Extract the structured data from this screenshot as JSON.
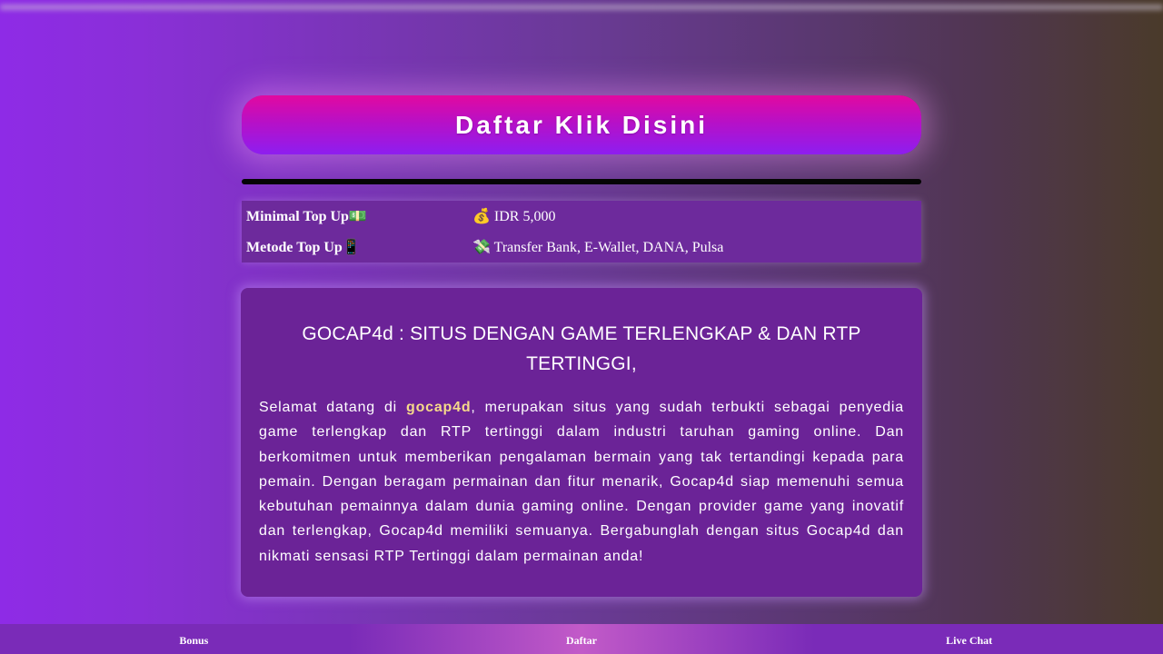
{
  "cta": {
    "label": "Daftar Klik Disini"
  },
  "info": {
    "rows": [
      {
        "key": "Minimal Top Up💵",
        "value": "💰 IDR 5,000"
      },
      {
        "key": "Metode Top Up📱",
        "value": "💸 Transfer Bank, E-Wallet, DANA, Pulsa"
      }
    ]
  },
  "content": {
    "title": "GOCAP4d : SITUS DENGAN GAME TERLENGKAP & DAN RTP TERTINGGI,",
    "intro": "Selamat datang di ",
    "brand": "gocap4d",
    "body": ", merupakan situs yang sudah terbukti sebagai penyedia game terlengkap dan RTP tertinggi dalam industri taruhan gaming online. Dan berkomitmen untuk memberikan pengalaman bermain yang tak tertandingi kepada para pemain. Dengan beragam permainan dan fitur menarik, Gocap4d siap memenuhi semua kebutuhan pemainnya dalam dunia gaming online. Dengan provider game yang inovatif dan terlengkap, Gocap4d memiliki semuanya. Bergabunglah dengan situs Gocap4d dan nikmati sensasi RTP Tertinggi dalam permainan anda!"
  },
  "bottom_nav": {
    "items": [
      {
        "label": "Bonus"
      },
      {
        "label": "Daftar"
      },
      {
        "label": "Live Chat"
      }
    ]
  }
}
